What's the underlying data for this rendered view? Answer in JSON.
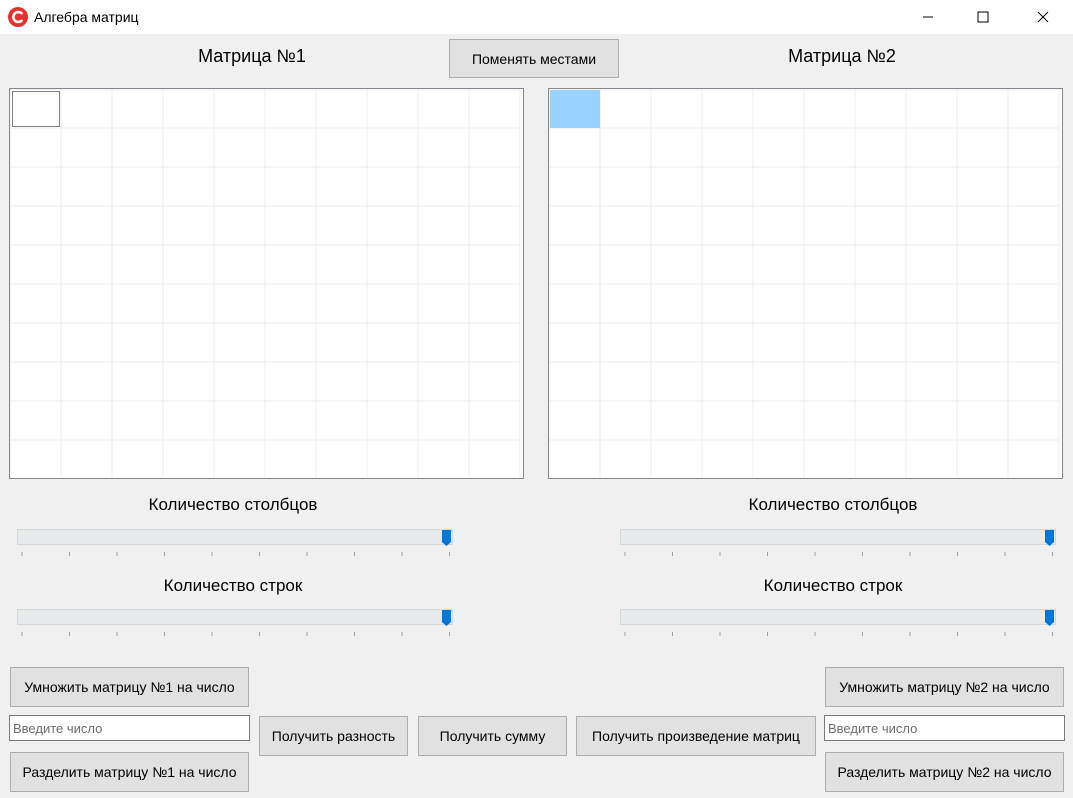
{
  "window": {
    "title": "Алгебра матриц",
    "controls": {
      "minimize": "minimize",
      "maximize": "maximize",
      "close": "close"
    }
  },
  "colors": {
    "accent": "#0078d7",
    "selected_cell": "#99d1ff",
    "app_icon": "#e8312f"
  },
  "swap_button": "Поменять местами",
  "matrix1": {
    "title": "Матрица №1",
    "columns_label": "Количество  столбцов",
    "rows_label": "Количество строк",
    "columns_slider_value": 1.0,
    "rows_slider_value": 1.0
  },
  "matrix2": {
    "title": "Матрица №2",
    "columns_label": "Количество  столбцов",
    "rows_label": "Количество строк",
    "columns_slider_value": 1.0,
    "rows_slider_value": 1.0
  },
  "actions": {
    "multiply_m1": "Умножить матрицу №1 на число",
    "divide_m1": "Разделить матрицу №1 на число",
    "input_m1_placeholder": "Введите число",
    "difference": "Получить разность",
    "sum": "Получить сумму",
    "product": "Получить произведение матриц",
    "multiply_m2": "Умножить матрицу №2 на число",
    "divide_m2": "Разделить матрицу №2 на число",
    "input_m2_placeholder": "Введите число"
  }
}
